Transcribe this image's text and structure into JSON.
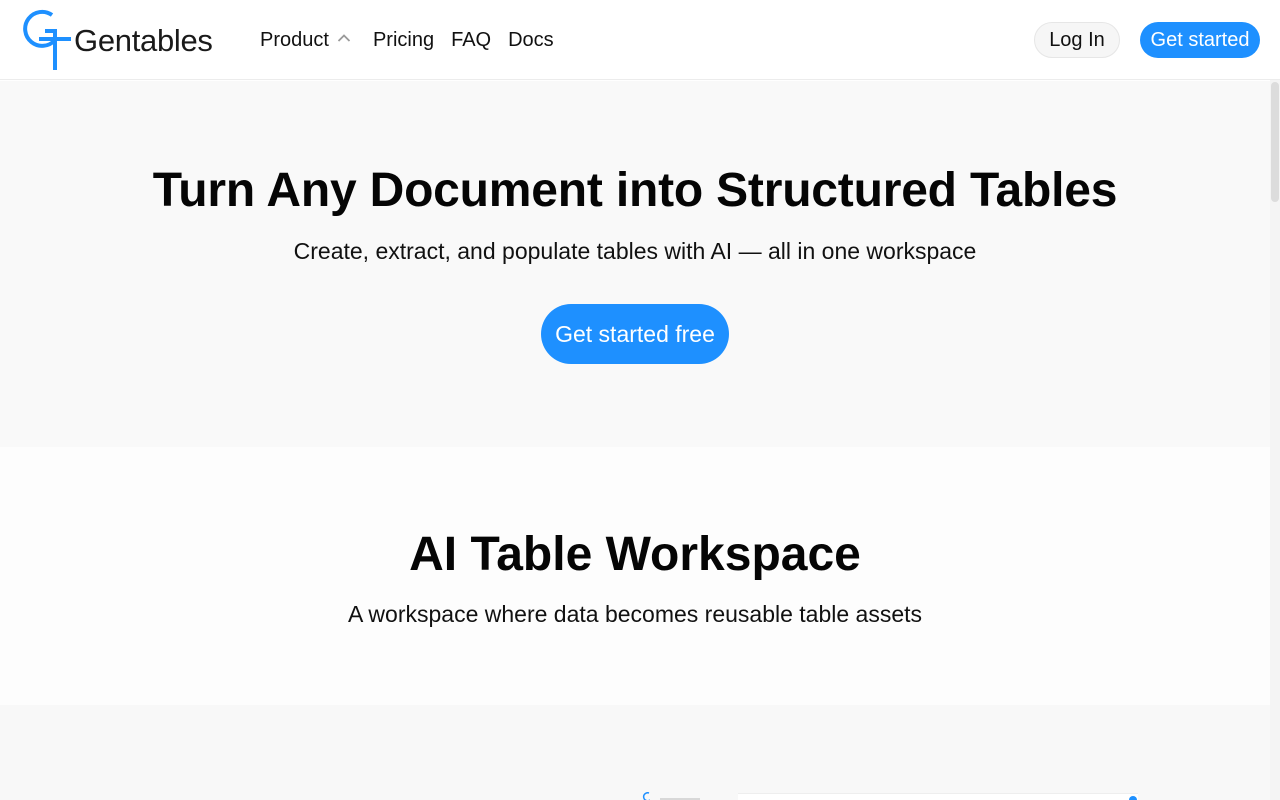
{
  "header": {
    "brand": "Gentables",
    "nav": {
      "product": "Product",
      "pricing": "Pricing",
      "faq": "FAQ",
      "docs": "Docs"
    },
    "login": "Log In",
    "get_started": "Get started"
  },
  "hero": {
    "title": "Turn Any Document into Structured Tables",
    "subtitle": "Create, extract, and populate tables with AI — all in one workspace",
    "cta": "Get started free"
  },
  "workspace": {
    "title": "AI Table Workspace",
    "subtitle": "A workspace where data becomes reusable table assets"
  },
  "colors": {
    "accent": "#1e90ff",
    "hero_bg": "#f9f9f9",
    "text": "#050505"
  },
  "icons": {
    "logo": "gentables-logo-icon",
    "product_chevron": "chevron-up-icon"
  }
}
